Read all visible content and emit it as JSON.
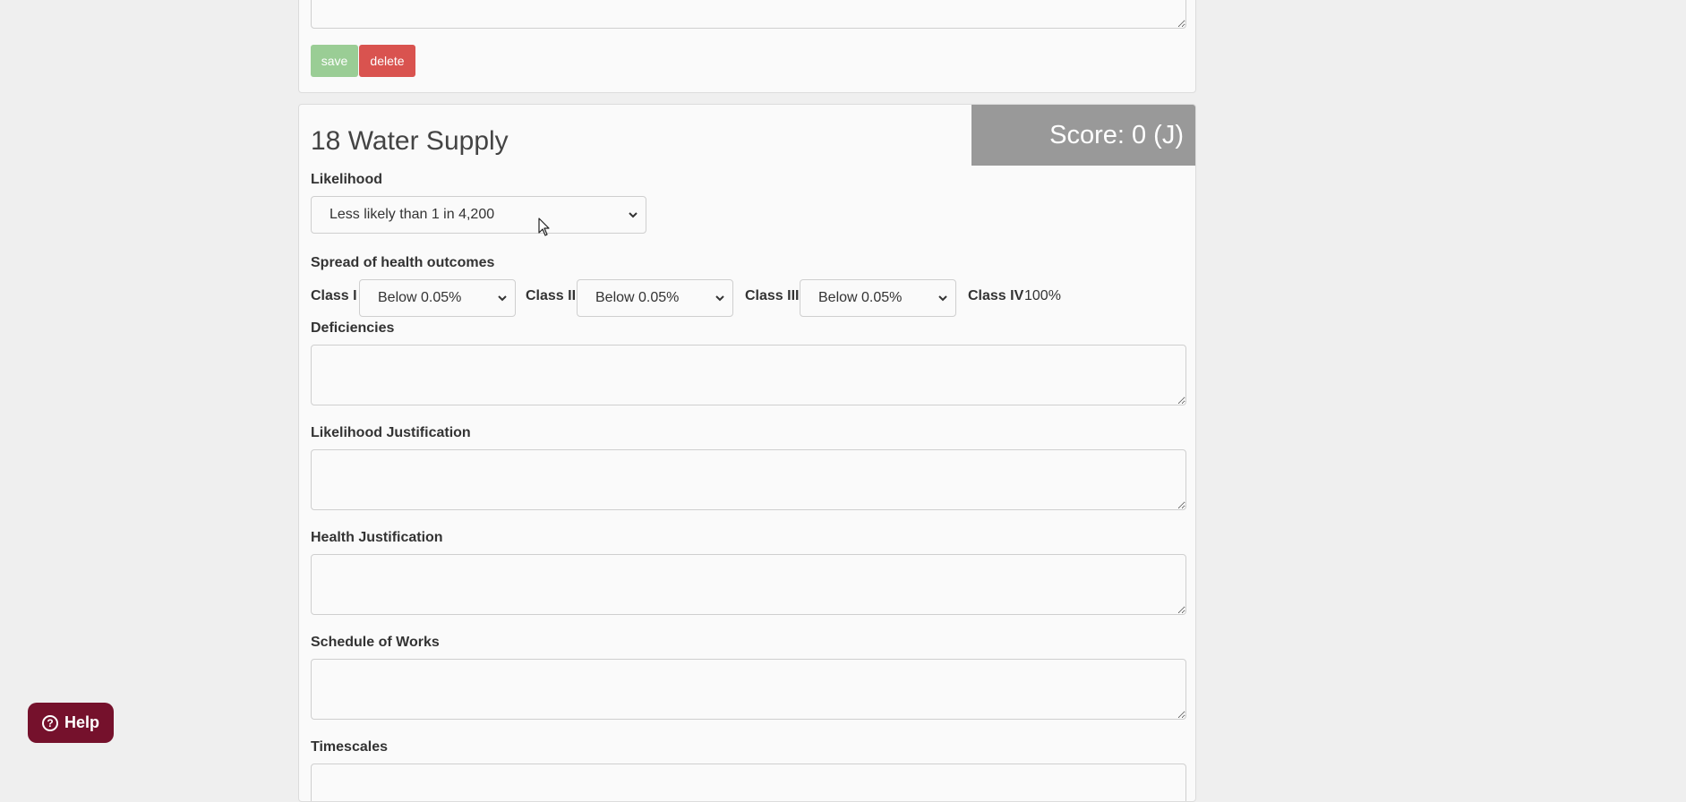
{
  "previous_section": {
    "save_label": "save",
    "delete_label": "delete"
  },
  "section": {
    "title": "18 Water Supply",
    "score": "Score: 0 (J)",
    "likelihood": {
      "label": "Likelihood",
      "selected": "Less likely than 1 in 4,200"
    },
    "spread": {
      "label": "Spread of health outcomes",
      "class_i": {
        "label": "Class I",
        "selected": "Below 0.05%"
      },
      "class_ii": {
        "label": "Class II",
        "selected": "Below 0.05%"
      },
      "class_iii": {
        "label": "Class III",
        "selected": "Below 0.05%"
      },
      "class_iv": {
        "label": "Class IV",
        "value": "100%"
      }
    },
    "deficiencies_label": "Deficiencies",
    "likelihood_justification_label": "Likelihood Justification",
    "health_justification_label": "Health Justification",
    "schedule_of_works_label": "Schedule of Works",
    "timescales_label": "Timescales"
  },
  "help_button": {
    "label": "Help",
    "icon": "question-circle-icon"
  },
  "colors": {
    "background": "#efefef",
    "card": "#fafafa",
    "save": "#9acd95",
    "delete": "#d9534f",
    "score_banner": "#999999",
    "help": "#75112c"
  }
}
